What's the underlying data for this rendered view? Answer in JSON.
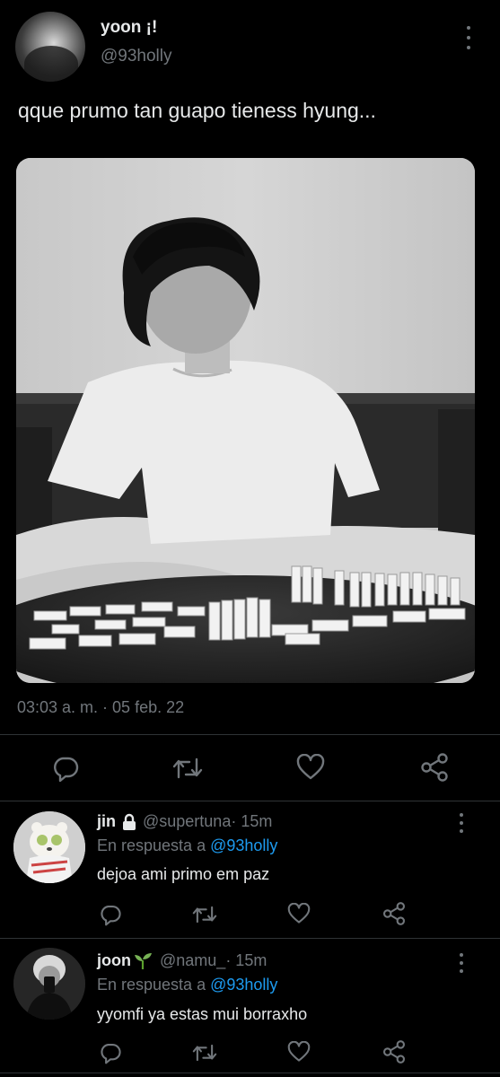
{
  "tweet": {
    "author_name": "yoon ¡!",
    "author_handle": "@93holly",
    "text": "qque prumo tan guapo tieness hyung...",
    "timestamp": "03:03 a. m. · 05 feb. 22"
  },
  "icons": {
    "more": "more-vertical-icon",
    "reply": "reply-bubble-icon",
    "retweet": "retweet-icon",
    "like": "heart-icon",
    "share": "share-icon",
    "lock": "lock-icon",
    "seedling": "seedling-emoji-icon"
  },
  "colors": {
    "background": "#000000",
    "primary_text": "#e7e9ea",
    "secondary_text": "#71767b",
    "mention": "#1d9bf0",
    "divider": "#2f3336"
  },
  "replies": [
    {
      "name": "jin",
      "handle": "@supertuna",
      "time_sep": " · 15m",
      "reply_prefix": "En respuesta a ",
      "reply_mention": "@93holly",
      "text": "dejoa ami primo em paz"
    },
    {
      "name": "joon",
      "handle": "@namu_",
      "time_sep": " · 15m",
      "reply_prefix": "En respuesta a ",
      "reply_mention": "@93holly",
      "text": "yyomfi ya estas mui borraxho"
    }
  ]
}
